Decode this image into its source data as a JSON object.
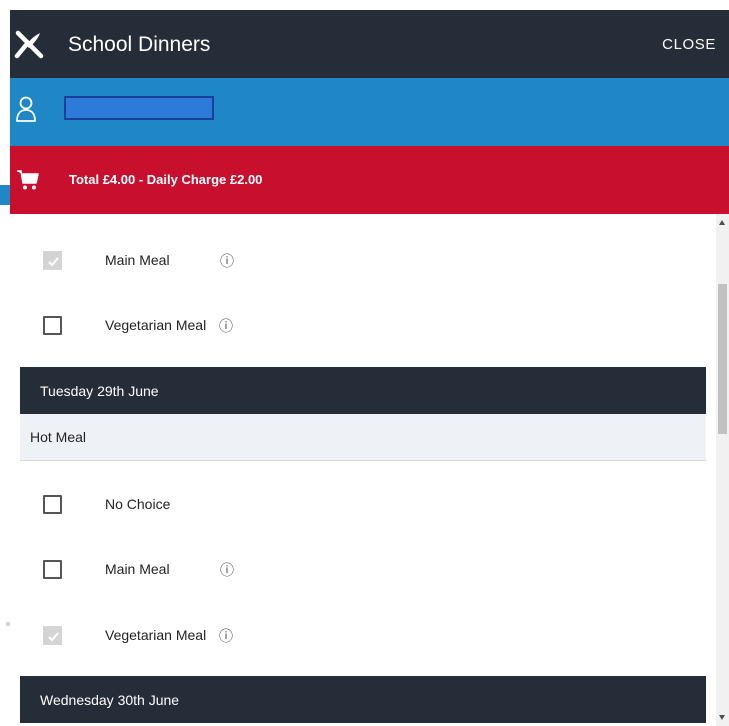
{
  "colors": {
    "dark": "#242d38",
    "user_blue": "#1f87c5",
    "cart_red": "#c8102e",
    "section_bg": "#eef1f5"
  },
  "header": {
    "title": "School Dinners",
    "close_label": "CLOSE",
    "logo_icon": "fork-knife-icon"
  },
  "user": {
    "icon": "user-icon",
    "name": ""
  },
  "cart": {
    "icon": "cart-icon",
    "total_text": "Total £4.00 - Daily Charge £2.00"
  },
  "monday": {
    "options": [
      {
        "label": "Main Meal",
        "checked": true,
        "info": "ⓘ"
      },
      {
        "label": "Vegetarian Meal",
        "checked": false,
        "info": "ⓘ"
      }
    ]
  },
  "tuesday": {
    "day_label": "Tuesday 29th June",
    "section_label": "Hot Meal",
    "options": [
      {
        "label": "No Choice",
        "checked": false
      },
      {
        "label": "Main Meal",
        "checked": false,
        "info": "ⓘ"
      },
      {
        "label": "Vegetarian Meal",
        "checked": true,
        "info": "ⓘ"
      }
    ]
  },
  "wednesday": {
    "day_label": "Wednesday 30th June"
  }
}
